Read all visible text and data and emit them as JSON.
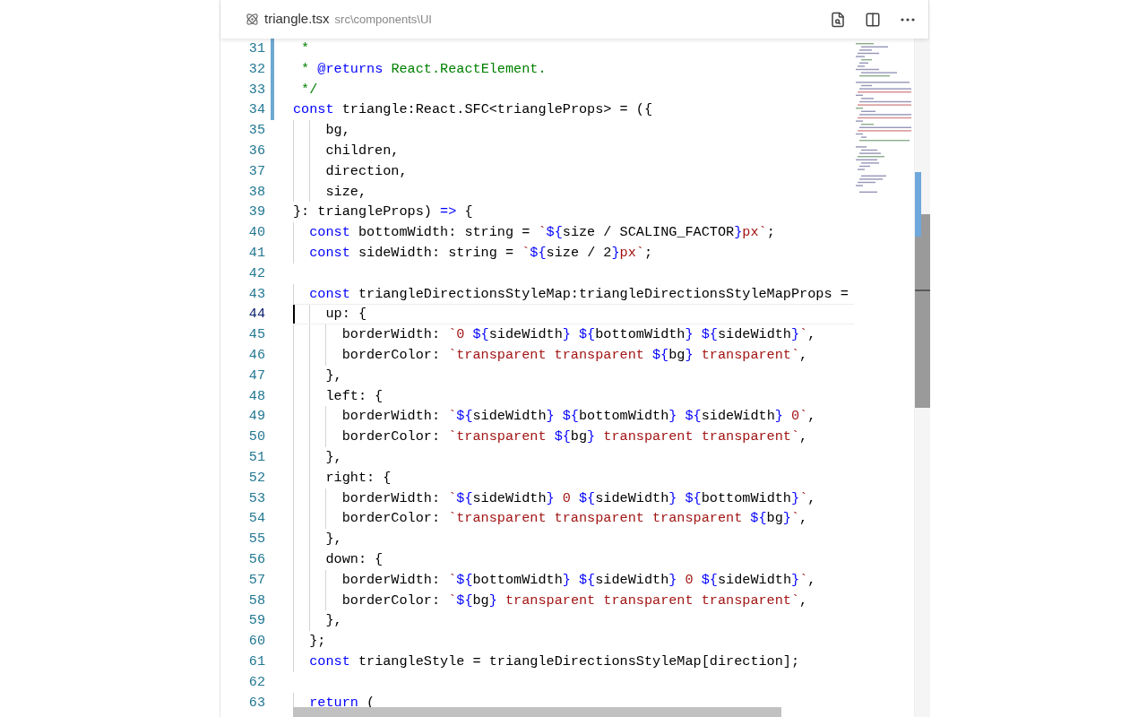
{
  "tab": {
    "file_name": "triangle.tsx",
    "path": "src\\components\\UI"
  },
  "lines": [
    {
      "number": "31",
      "modified": true,
      "current": false,
      "tokens": [
        {
          "kind": "comment",
          "text": " *"
        }
      ]
    },
    {
      "number": "32",
      "modified": true,
      "current": false,
      "tokens": [
        {
          "kind": "comment",
          "text": " * "
        },
        {
          "kind": "doc_tag",
          "text": "@returns"
        },
        {
          "kind": "comment",
          "text": " React.ReactElement."
        }
      ]
    },
    {
      "number": "33",
      "modified": true,
      "current": false,
      "tokens": [
        {
          "kind": "comment",
          "text": " */"
        }
      ]
    },
    {
      "number": "34",
      "modified": true,
      "current": false,
      "tokens": [
        {
          "kind": "keyword",
          "text": "const"
        },
        {
          "kind": "plain",
          "text": " triangle:React.SFC<triangleProps> = ({"
        }
      ]
    },
    {
      "number": "35",
      "modified": false,
      "current": false,
      "tokens": [
        {
          "kind": "plain",
          "text": "    bg,"
        }
      ]
    },
    {
      "number": "36",
      "modified": false,
      "current": false,
      "tokens": [
        {
          "kind": "plain",
          "text": "    children,"
        }
      ]
    },
    {
      "number": "37",
      "modified": false,
      "current": false,
      "tokens": [
        {
          "kind": "plain",
          "text": "    direction,"
        }
      ]
    },
    {
      "number": "38",
      "modified": false,
      "current": false,
      "tokens": [
        {
          "kind": "plain",
          "text": "    size,"
        }
      ]
    },
    {
      "number": "39",
      "modified": false,
      "current": false,
      "tokens": [
        {
          "kind": "plain",
          "text": "}: triangleProps) "
        },
        {
          "kind": "keyword",
          "text": "=>"
        },
        {
          "kind": "plain",
          "text": " {"
        }
      ]
    },
    {
      "number": "40",
      "modified": false,
      "current": false,
      "tokens": [
        {
          "kind": "keyword",
          "text": "  const"
        },
        {
          "kind": "plain",
          "text": " bottomWidth: string = "
        },
        {
          "kind": "string",
          "text": "`"
        },
        {
          "kind": "template",
          "text": "${"
        },
        {
          "kind": "plain",
          "text": "size / SCALING_FACTOR"
        },
        {
          "kind": "template",
          "text": "}"
        },
        {
          "kind": "string",
          "text": "px`"
        },
        {
          "kind": "plain",
          "text": ";"
        }
      ]
    },
    {
      "number": "41",
      "modified": false,
      "current": false,
      "tokens": [
        {
          "kind": "keyword",
          "text": "  const"
        },
        {
          "kind": "plain",
          "text": " sideWidth: string = "
        },
        {
          "kind": "string",
          "text": "`"
        },
        {
          "kind": "template",
          "text": "${"
        },
        {
          "kind": "plain",
          "text": "size / 2"
        },
        {
          "kind": "template",
          "text": "}"
        },
        {
          "kind": "string",
          "text": "px`"
        },
        {
          "kind": "plain",
          "text": ";"
        }
      ]
    },
    {
      "number": "42",
      "modified": false,
      "current": false
    },
    {
      "number": "43",
      "modified": false,
      "current": false,
      "tokens": [
        {
          "kind": "keyword",
          "text": "  const"
        },
        {
          "kind": "plain",
          "text": " triangleDirectionsStyleMap:triangleDirectionsStyleMapProps ="
        }
      ]
    },
    {
      "number": "44",
      "modified": false,
      "current": true,
      "tokens": [
        {
          "kind": "plain",
          "text": "    up: {"
        }
      ]
    },
    {
      "number": "45",
      "modified": false,
      "current": false,
      "tokens": [
        {
          "kind": "plain",
          "text": "      borderWidth: "
        },
        {
          "kind": "string",
          "text": "`0 "
        },
        {
          "kind": "template",
          "text": "${"
        },
        {
          "kind": "plain",
          "text": "sideWidth"
        },
        {
          "kind": "template",
          "text": "} ${"
        },
        {
          "kind": "plain",
          "text": "bottomWidth"
        },
        {
          "kind": "template",
          "text": "} ${"
        },
        {
          "kind": "plain",
          "text": "sideWidth"
        },
        {
          "kind": "template",
          "text": "}"
        },
        {
          "kind": "string",
          "text": "`"
        },
        {
          "kind": "plain",
          "text": ","
        }
      ]
    },
    {
      "number": "46",
      "modified": false,
      "current": false,
      "tokens": [
        {
          "kind": "plain",
          "text": "      borderColor: "
        },
        {
          "kind": "string",
          "text": "`transparent transparent "
        },
        {
          "kind": "template",
          "text": "${"
        },
        {
          "kind": "plain",
          "text": "bg"
        },
        {
          "kind": "template",
          "text": "}"
        },
        {
          "kind": "string",
          "text": " transparent`"
        },
        {
          "kind": "plain",
          "text": ","
        }
      ]
    },
    {
      "number": "47",
      "modified": false,
      "current": false,
      "tokens": [
        {
          "kind": "plain",
          "text": "    },"
        }
      ]
    },
    {
      "number": "48",
      "modified": false,
      "current": false,
      "tokens": [
        {
          "kind": "plain",
          "text": "    left: {"
        }
      ]
    },
    {
      "number": "49",
      "modified": false,
      "current": false,
      "tokens": [
        {
          "kind": "plain",
          "text": "      borderWidth: "
        },
        {
          "kind": "string",
          "text": "`"
        },
        {
          "kind": "template",
          "text": "${"
        },
        {
          "kind": "plain",
          "text": "sideWidth"
        },
        {
          "kind": "template",
          "text": "} ${"
        },
        {
          "kind": "plain",
          "text": "bottomWidth"
        },
        {
          "kind": "template",
          "text": "} ${"
        },
        {
          "kind": "plain",
          "text": "sideWidth"
        },
        {
          "kind": "template",
          "text": "}"
        },
        {
          "kind": "string",
          "text": " 0`"
        },
        {
          "kind": "plain",
          "text": ","
        }
      ]
    },
    {
      "number": "50",
      "modified": false,
      "current": false,
      "tokens": [
        {
          "kind": "plain",
          "text": "      borderColor: "
        },
        {
          "kind": "string",
          "text": "`transparent "
        },
        {
          "kind": "template",
          "text": "${"
        },
        {
          "kind": "plain",
          "text": "bg"
        },
        {
          "kind": "template",
          "text": "}"
        },
        {
          "kind": "string",
          "text": " transparent transparent`"
        },
        {
          "kind": "plain",
          "text": ","
        }
      ]
    },
    {
      "number": "51",
      "modified": false,
      "current": false,
      "tokens": [
        {
          "kind": "plain",
          "text": "    },"
        }
      ]
    },
    {
      "number": "52",
      "modified": false,
      "current": false,
      "tokens": [
        {
          "kind": "plain",
          "text": "    right: {"
        }
      ]
    },
    {
      "number": "53",
      "modified": false,
      "current": false,
      "tokens": [
        {
          "kind": "plain",
          "text": "      borderWidth: "
        },
        {
          "kind": "string",
          "text": "`"
        },
        {
          "kind": "template",
          "text": "${"
        },
        {
          "kind": "plain",
          "text": "sideWidth"
        },
        {
          "kind": "template",
          "text": "}"
        },
        {
          "kind": "string",
          "text": " 0 "
        },
        {
          "kind": "template",
          "text": "${"
        },
        {
          "kind": "plain",
          "text": "sideWidth"
        },
        {
          "kind": "template",
          "text": "} ${"
        },
        {
          "kind": "plain",
          "text": "bottomWidth"
        },
        {
          "kind": "template",
          "text": "}"
        },
        {
          "kind": "string",
          "text": "`"
        },
        {
          "kind": "plain",
          "text": ","
        }
      ]
    },
    {
      "number": "54",
      "modified": false,
      "current": false,
      "tokens": [
        {
          "kind": "plain",
          "text": "      borderColor: "
        },
        {
          "kind": "string",
          "text": "`transparent transparent transparent "
        },
        {
          "kind": "template",
          "text": "${"
        },
        {
          "kind": "plain",
          "text": "bg"
        },
        {
          "kind": "template",
          "text": "}"
        },
        {
          "kind": "string",
          "text": "`"
        },
        {
          "kind": "plain",
          "text": ","
        }
      ]
    },
    {
      "number": "55",
      "modified": false,
      "current": false,
      "tokens": [
        {
          "kind": "plain",
          "text": "    },"
        }
      ]
    },
    {
      "number": "56",
      "modified": false,
      "current": false,
      "tokens": [
        {
          "kind": "plain",
          "text": "    down: {"
        }
      ]
    },
    {
      "number": "57",
      "modified": false,
      "current": false,
      "tokens": [
        {
          "kind": "plain",
          "text": "      borderWidth: "
        },
        {
          "kind": "string",
          "text": "`"
        },
        {
          "kind": "template",
          "text": "${"
        },
        {
          "kind": "plain",
          "text": "bottomWidth"
        },
        {
          "kind": "template",
          "text": "} ${"
        },
        {
          "kind": "plain",
          "text": "sideWidth"
        },
        {
          "kind": "template",
          "text": "}"
        },
        {
          "kind": "string",
          "text": " 0 "
        },
        {
          "kind": "template",
          "text": "${"
        },
        {
          "kind": "plain",
          "text": "sideWidth"
        },
        {
          "kind": "template",
          "text": "}"
        },
        {
          "kind": "string",
          "text": "`"
        },
        {
          "kind": "plain",
          "text": ","
        }
      ]
    },
    {
      "number": "58",
      "modified": false,
      "current": false,
      "tokens": [
        {
          "kind": "plain",
          "text": "      borderColor: "
        },
        {
          "kind": "string",
          "text": "`"
        },
        {
          "kind": "template",
          "text": "${"
        },
        {
          "kind": "plain",
          "text": "bg"
        },
        {
          "kind": "template",
          "text": "}"
        },
        {
          "kind": "string",
          "text": " transparent transparent transparent`"
        },
        {
          "kind": "plain",
          "text": ","
        }
      ]
    },
    {
      "number": "59",
      "modified": false,
      "current": false,
      "tokens": [
        {
          "kind": "plain",
          "text": "    },"
        }
      ]
    },
    {
      "number": "60",
      "modified": false,
      "current": false,
      "tokens": [
        {
          "kind": "plain",
          "text": "  };"
        }
      ]
    },
    {
      "number": "61",
      "modified": false,
      "current": false,
      "tokens": [
        {
          "kind": "keyword",
          "text": "  const"
        },
        {
          "kind": "plain",
          "text": " triangleStyle = triangleDirectionsStyleMap[direction];"
        }
      ]
    },
    {
      "number": "62",
      "modified": false,
      "current": false
    },
    {
      "number": "63",
      "modified": false,
      "current": false,
      "tokens": [
        {
          "kind": "keyword",
          "text": "  return"
        },
        {
          "kind": "plain",
          "text": " ("
        }
      ]
    }
  ]
}
